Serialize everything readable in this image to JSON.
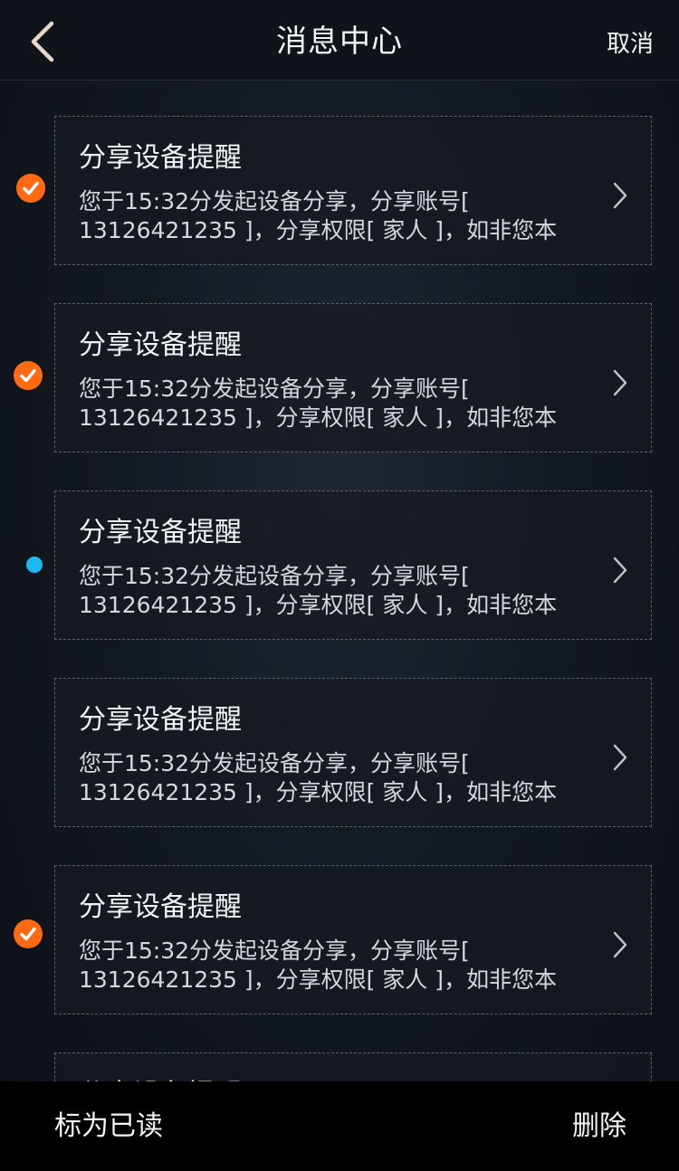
{
  "header": {
    "title": "消息中心",
    "cancel_label": "取消",
    "back_icon": "chevron-left-icon"
  },
  "colors": {
    "accent_orange": "#ff6a13",
    "unread_blue": "#19b8f0",
    "background": "#141a22"
  },
  "messages": [
    {
      "title": "分享设备提醒",
      "body": "您于15:32分发起设备分享，分享账号[ 13126421235 ]，分享权限[ 家人 ]，如非您本人...",
      "state": "selected"
    },
    {
      "title": "分享设备提醒",
      "body": "您于15:32分发起设备分享，分享账号[ 13126421235 ]，分享权限[ 家人 ]，如非您本人...",
      "state": "selected"
    },
    {
      "title": "分享设备提醒",
      "body": "您于15:32分发起设备分享，分享账号[ 13126421235 ]，分享权限[ 家人 ]，如非您本人...",
      "state": "unread"
    },
    {
      "title": "分享设备提醒",
      "body": "您于15:32分发起设备分享，分享账号[ 13126421235 ]，分享权限[ 家人 ]，如非您本人...",
      "state": "read"
    },
    {
      "title": "分享设备提醒",
      "body": "您于15:32分发起设备分享，分享账号[ 13126421235 ]，分享权限[ 家人 ]，如非您本人...",
      "state": "selected"
    },
    {
      "title": "分享设备提醒",
      "body": "",
      "state": "read"
    }
  ],
  "bottom_bar": {
    "mark_read_label": "标为已读",
    "delete_label": "删除"
  }
}
